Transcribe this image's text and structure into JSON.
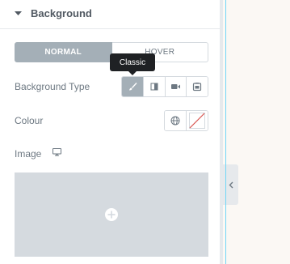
{
  "section": {
    "title": "Background",
    "collapse_icon": "caret-down-icon"
  },
  "tabs": [
    {
      "label": "NORMAL",
      "active": true
    },
    {
      "label": "HOVER",
      "active": false
    }
  ],
  "background_type": {
    "label": "Background Type",
    "tooltip": "Classic",
    "options": [
      {
        "icon": "paint-brush-icon",
        "active": true
      },
      {
        "icon": "gradient-icon",
        "active": false
      },
      {
        "icon": "video-camera-icon",
        "active": false
      },
      {
        "icon": "slideshow-icon",
        "active": false
      }
    ]
  },
  "colour": {
    "label": "Colour",
    "global_icon": "globe-icon",
    "swatch_icon": "no-color-swatch-icon"
  },
  "image": {
    "label": "Image",
    "device_icon": "desktop-monitor-icon",
    "add_icon": "plus-circle-icon"
  },
  "colors": {
    "accent_active": "#a4afb7",
    "tooltip_bg": "#1f2124",
    "canvas_bg": "#fbf8f4",
    "preview_line": "#71d7f7",
    "no_color_red": "#d9534f"
  }
}
